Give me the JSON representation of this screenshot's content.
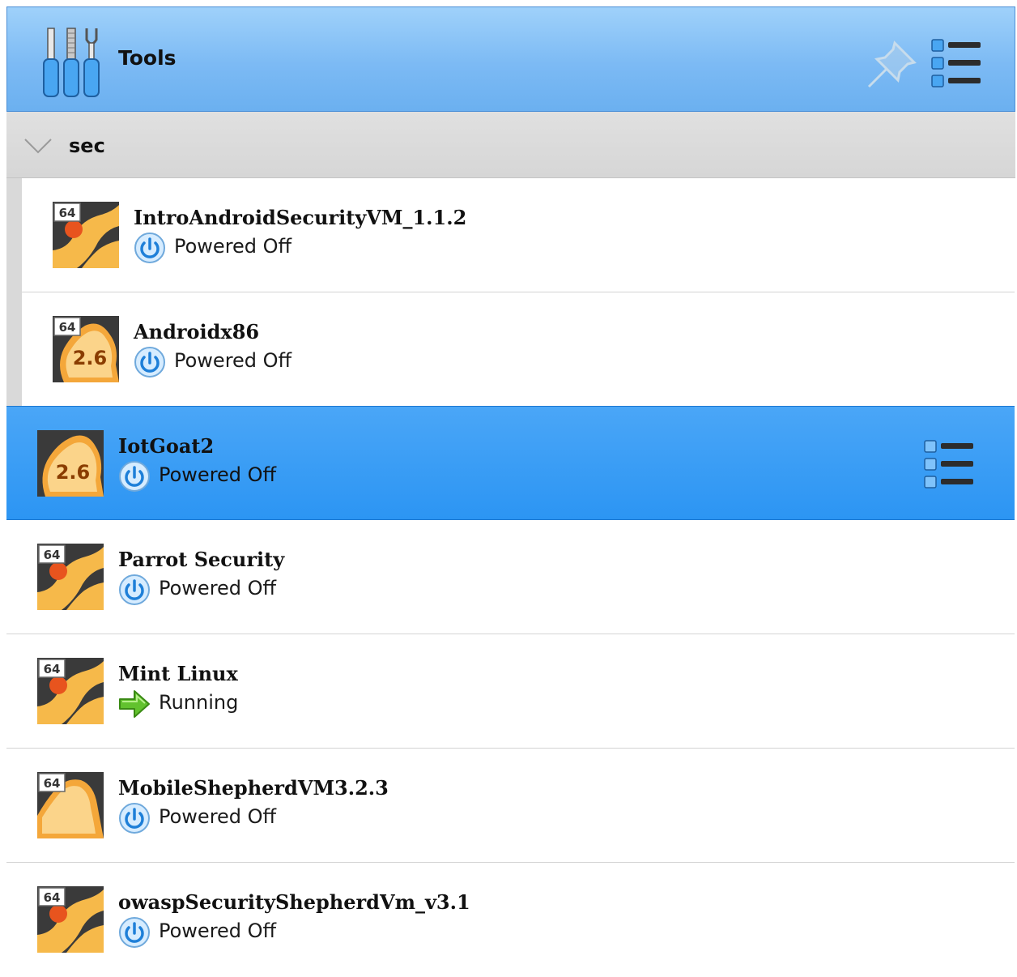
{
  "tools": {
    "title": "Tools",
    "icon": "tools-icon",
    "pin_icon": "pin-icon",
    "menu_icon": "menu-icon"
  },
  "group": {
    "name": "sec",
    "expanded": true
  },
  "machines": [
    {
      "name": "IntroAndroidSecurityVM_1.1.2",
      "state": "Powered Off",
      "os_icon": "linux-64-icon",
      "in_group": true
    },
    {
      "name": "Androidx86",
      "state": "Powered Off",
      "os_icon": "linux26-64-icon",
      "os_badge": "2.6",
      "arch_badge": "64",
      "in_group": true
    },
    {
      "name": "IotGoat2",
      "state": "Powered Off",
      "os_icon": "linux26-icon",
      "os_badge": "2.6",
      "selected": true
    },
    {
      "name": "Parrot Security",
      "state": "Powered Off",
      "os_icon": "linux-64-icon"
    },
    {
      "name": "Mint Linux",
      "state": "Running",
      "os_icon": "linux-64-icon"
    },
    {
      "name": "MobileShepherdVM3.2.3",
      "state": "Powered Off",
      "os_icon": "other-linux-64-icon"
    },
    {
      "name": "owaspSecurityShepherdVm_v3.1",
      "state": "Powered Off",
      "os_icon": "linux-64-icon"
    }
  ],
  "colors": {
    "header_blue": "#7cbaf4",
    "selection_blue": "#2c95f3",
    "group_gray": "#d9d9d9",
    "os_orange": "#f4a73a",
    "power_blue": "#1e7fd8",
    "running_green": "#56b829"
  },
  "arch_label": "64"
}
